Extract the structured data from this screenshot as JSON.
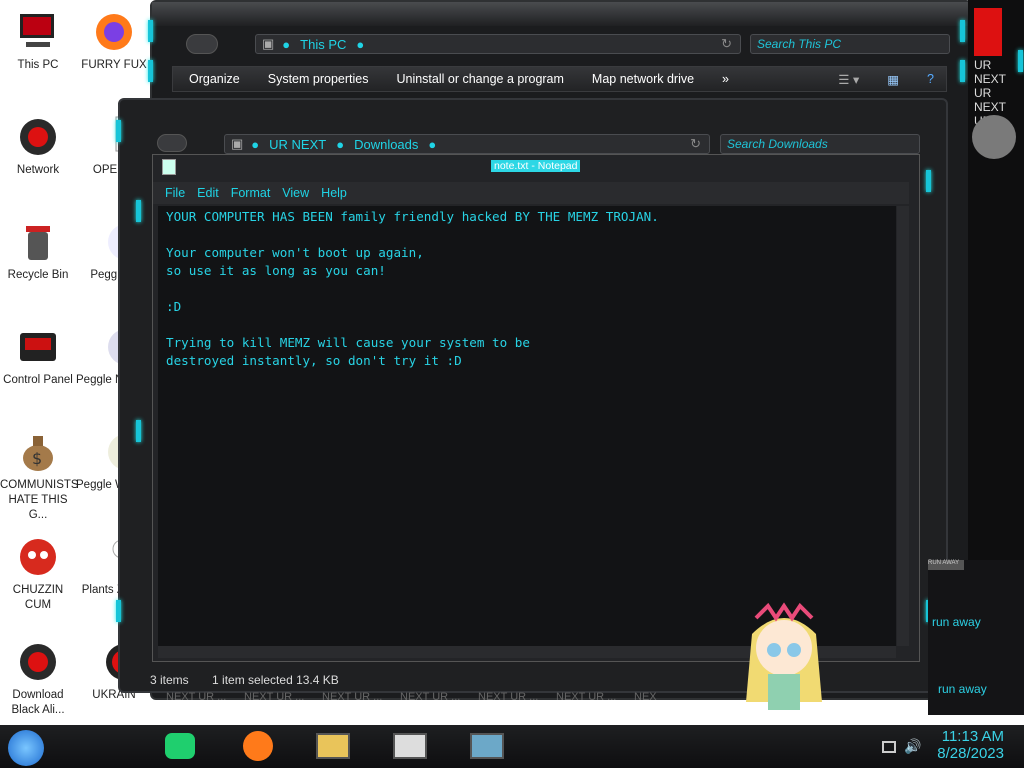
{
  "desktop": {
    "icons_col1": [
      {
        "label": "This PC",
        "icon": "pc-icon"
      },
      {
        "label": "Network",
        "icon": "network-icon"
      },
      {
        "label": "Recycle Bin",
        "icon": "recycle-bin-icon"
      },
      {
        "label": "Control Panel",
        "icon": "control-panel-icon"
      },
      {
        "label": "COMMUNISTS HATE THIS G...",
        "icon": "money-bag-icon"
      },
      {
        "label": "CHUZZIN CUM",
        "icon": "chuzzle-icon"
      },
      {
        "label": "Download Black Ali...",
        "icon": "alienware-icon"
      }
    ],
    "icons_col2": [
      {
        "label": "FURRY FUX",
        "icon": "firefox-icon"
      },
      {
        "label": "OPENM",
        "icon": "document-icon"
      },
      {
        "label": "Peggle D",
        "icon": "peggle-icon"
      },
      {
        "label": "Peggle N Delux",
        "icon": "peggle-icon"
      },
      {
        "label": "Peggle W of Warcr",
        "icon": "peggle-icon"
      },
      {
        "label": "Plants Zomb",
        "icon": "plants-icon"
      },
      {
        "label": "UKRAIN",
        "icon": "ukraine-icon"
      }
    ]
  },
  "explorer_back": {
    "address": "This PC",
    "search_placeholder": "Search This PC",
    "commands": [
      "Organize",
      "System properties",
      "Uninstall or change a program",
      "Map network drive",
      "»"
    ]
  },
  "explorer_mid": {
    "breadcrumb": [
      "UR NEXT",
      "Downloads"
    ],
    "search_placeholder": "Search Downloads",
    "status_items": "3 items",
    "status_selected": "1 item selected  13.4 KB"
  },
  "notepad": {
    "title": "note.txt - Notepad",
    "menu": [
      "File",
      "Edit",
      "Format",
      "View",
      "Help"
    ],
    "content": "YOUR COMPUTER HAS BEEN family friendly hacked BY THE MEMZ TROJAN.\n\nYour computer won't boot up again,\nso use it as long as you can!\n\n:D\n\nTrying to kill MEMZ will cause your system to be\ndestroyed instantly, so don't try it :D"
  },
  "side_panel": {
    "text": "UR NEXT UR NEXT UR ...",
    "labels": [
      "RUN AWAY",
      "run away"
    ]
  },
  "taskbar": {
    "labels": [
      "NEXT UR ...",
      "NEXT UR ...",
      "NEXT UR ...",
      "NEXT UR ...",
      "NEXT UR ...",
      "NEXT UR ...",
      "NEX"
    ],
    "time": "11:13 AM",
    "date": "8/28/2023"
  },
  "colors": {
    "accent": "#1fd4e6",
    "frame": "#1b1c1e"
  }
}
